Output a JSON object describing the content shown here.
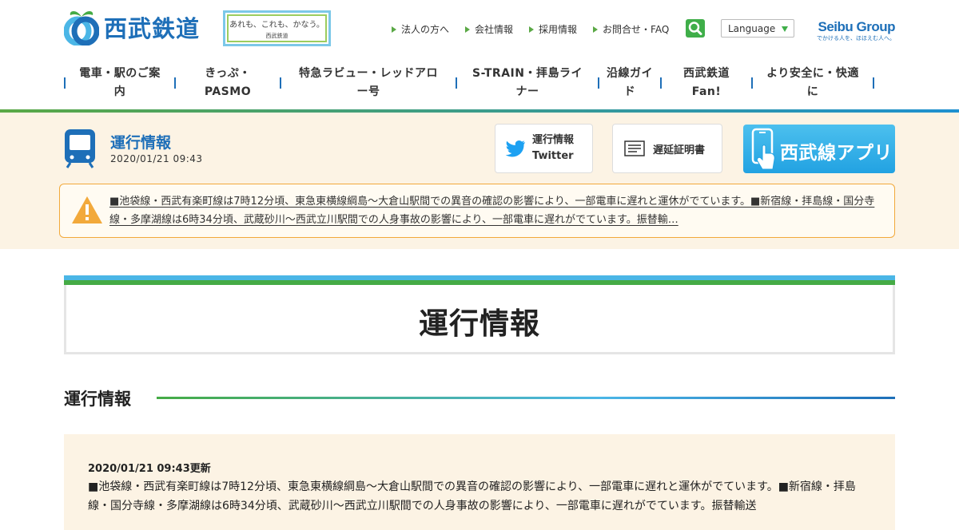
{
  "header": {
    "logo_text": "西武鉄道",
    "slogan_main": "あれも、これも、かなう。",
    "slogan_sub": "西武鉄道",
    "util_links": [
      "法人の方へ",
      "会社情報",
      "採用情報",
      "お問合せ・FAQ"
    ],
    "language_label": "Language",
    "group_logo": "Seibu Group",
    "group_tagline": "でかける人を、ほほえむ人へ。"
  },
  "gnav": [
    {
      "label": "電車・駅のご案内",
      "w": 138
    },
    {
      "label": "きっぷ・PASMO",
      "w": 132
    },
    {
      "label": "特急ラビュー・レッドアロー号",
      "w": 220
    },
    {
      "label": "S-TRAIN・拝島ライナー",
      "w": 178
    },
    {
      "label": "沿線ガイド",
      "w": 276
    },
    {
      "label": "西武鉄道Fan!",
      "w": 0
    },
    {
      "label": "より安全に・快適に",
      "w": 0
    }
  ],
  "status": {
    "title": "運行情報",
    "time": "2020/01/21 09:43",
    "twitter_label_1": "運行情報",
    "twitter_label_2": "Twitter",
    "delay_label": "遅延証明書",
    "app_label": "西武線アプリ",
    "alert_text": "■池袋線・西武有楽町線は7時12分頃、東急東横線綱島～大倉山駅間での異音の確認の影響により、一部電車に遅れと運休がでています。■新宿線・拝島線・国分寺線・多摩湖線は6時34分頃、武蔵砂川～西武立川駅間での人身事故の影響により、一部電車に遅れがでています。振替輸…"
  },
  "main": {
    "page_title": "運行情報",
    "section_title": "運行情報",
    "updated": "2020/01/21 09:43更新",
    "body": "■池袋線・西武有楽町線は7時12分頃、東急東横線綱島～大倉山駅間での異音の確認の影響により、一部電車に遅れと運休がでています。■新宿線・拝島線・国分寺線・多摩湖線は6時34分頃、武蔵砂川～西武立川駅間での人身事故の影響により、一部電車に遅れがでています。振替輸送"
  },
  "colors": {
    "brand_blue": "#1e6fb8",
    "brand_green": "#45ab45",
    "sky": "#4bb6e6",
    "band_bg": "#fcf3e4",
    "warning": "#f2a93b"
  }
}
